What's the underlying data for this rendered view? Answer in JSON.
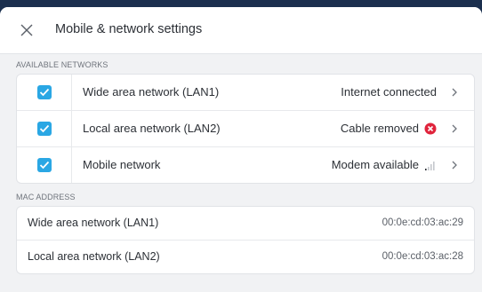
{
  "dialog": {
    "title": "Mobile & network settings"
  },
  "networks": {
    "section_label": "AVAILABLE NETWORKS",
    "items": [
      {
        "name": "Wide area network (LAN1)",
        "status": "Internet connected",
        "status_icon": "none",
        "checked": true
      },
      {
        "name": "Local area network (LAN2)",
        "status": "Cable removed",
        "status_icon": "error-icon",
        "checked": true
      },
      {
        "name": "Mobile network",
        "status": "Modem available",
        "status_icon": "signal-strength-icon",
        "checked": true
      }
    ]
  },
  "mac": {
    "section_label": "MAC ADDRESS",
    "items": [
      {
        "name": "Wide area network (LAN1)",
        "value": "00:0e:cd:03:ac:29"
      },
      {
        "name": "Local area network (LAN2)",
        "value": "00:0e:cd:03:ac:28"
      }
    ]
  },
  "colors": {
    "checkbox": "#2aa7e4",
    "error": "#e0243c",
    "background_top": "#1b2f4e"
  }
}
